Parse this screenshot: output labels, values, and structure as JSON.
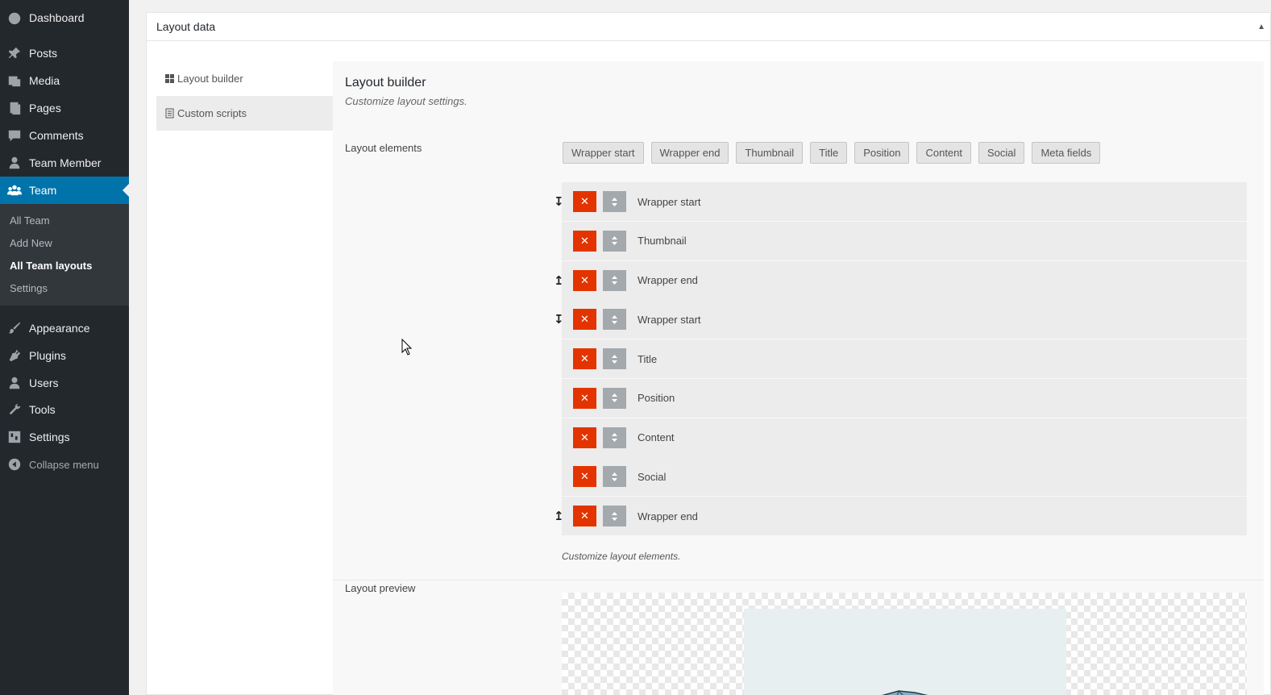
{
  "sidebar": {
    "items": [
      {
        "label": "Dashboard",
        "icon": "dashboard-icon"
      },
      {
        "label": "Posts",
        "icon": "pushpin-icon"
      },
      {
        "label": "Media",
        "icon": "media-icon"
      },
      {
        "label": "Pages",
        "icon": "pages-icon"
      },
      {
        "label": "Comments",
        "icon": "comment-icon"
      },
      {
        "label": "Team Member",
        "icon": "user-icon"
      },
      {
        "label": "Team",
        "icon": "group-icon"
      },
      {
        "label": "Appearance",
        "icon": "paintbrush-icon"
      },
      {
        "label": "Plugins",
        "icon": "plugin-icon"
      },
      {
        "label": "Users",
        "icon": "users-icon"
      },
      {
        "label": "Tools",
        "icon": "wrench-icon"
      },
      {
        "label": "Settings",
        "icon": "settings-icon"
      },
      {
        "label": "Collapse menu",
        "icon": "collapse-icon"
      }
    ],
    "submenu": [
      "All Team",
      "Add New",
      "All Team layouts",
      "Settings"
    ]
  },
  "panel": {
    "title": "Layout data"
  },
  "tabs": [
    {
      "label": "Layout builder",
      "icon": "grid-icon"
    },
    {
      "label": "Custom scripts",
      "icon": "code-icon"
    }
  ],
  "content": {
    "title": "Layout builder",
    "description": "Customize layout settings.",
    "elements_label": "Layout elements",
    "elements_desc": "Customize layout elements.",
    "preview_label": "Layout preview"
  },
  "chips": [
    "Wrapper start",
    "Wrapper end",
    "Thumbnail",
    "Title",
    "Position",
    "Content",
    "Social",
    "Meta fields"
  ],
  "layout_rows": [
    {
      "label": "Wrapper start",
      "arrow": "↧"
    },
    {
      "label": "Thumbnail",
      "arrow": ""
    },
    {
      "label": "Wrapper end",
      "arrow": "↥"
    },
    {
      "label": "Wrapper start",
      "arrow": "↧"
    },
    {
      "label": "Title",
      "arrow": ""
    },
    {
      "label": "Position",
      "arrow": ""
    },
    {
      "label": "Content",
      "arrow": ""
    },
    {
      "label": "Social",
      "arrow": ""
    },
    {
      "label": "Wrapper end",
      "arrow": "↥"
    }
  ],
  "colors": {
    "sidebar_bg": "#23282d",
    "active_menu": "#0073aa",
    "delete_button": "#e33400",
    "move_button": "#a4a9ad"
  }
}
